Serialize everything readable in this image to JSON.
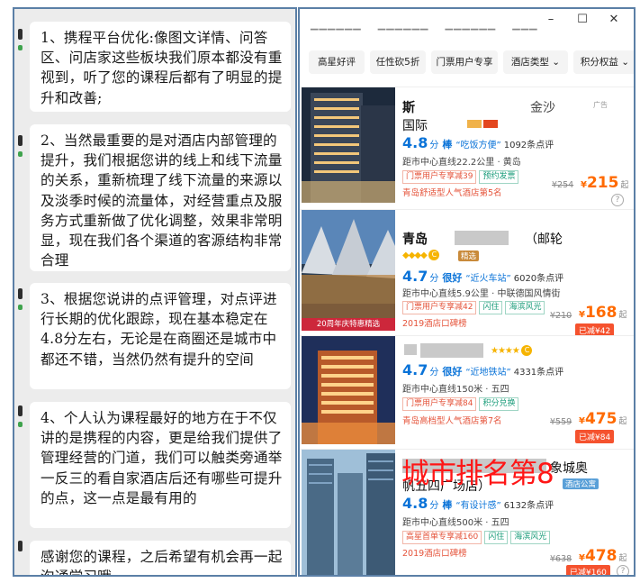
{
  "chat": {
    "messages": [
      "1、携程平台优化:像图文详情、问答区、问店家这些板块我们原本都没有重视到，听了您的课程后都有了明显的提升和改善;",
      "2、当然最重要的是对酒店内部管理的提升，我们根据您讲的线上和线下流量的关系，重新梳理了线下流量的来源以及淡季时候的流量体，对经营重点及服务方式重新做了优化调整，效果非常明显，现在我们各个渠道的客源结构非常合理",
      "3、根据您说讲的点评管理，对点评进行长期的优化跟踪，现在基本稳定在4.8分左右，无论是在商圈还是城市中都还不错，当然仍然有提升的空间",
      "4、个人认为课程最好的地方在于不仅讲的是携程的内容，更是给我们提供了管理经营的门道，我们可以触类旁通举一反三的看自家酒店后还有哪些可提升的点，这一点是最有用的",
      "感谢您的课程，之后希望有机会再一起沟通学习哦"
    ]
  },
  "window": {
    "minimize": "–",
    "maximize": "☐",
    "close": "✕"
  },
  "filters": [
    "高星好评",
    "任性砍5折",
    "门票用户专享",
    "酒店类型",
    "积分权益"
  ],
  "filter_caret": "⌄",
  "hotels": [
    {
      "name": "斯",
      "name2": "国际",
      "name_tail": "金沙",
      "ad": "广告",
      "score": "4.8",
      "score_unit": "分",
      "level": "棒",
      "quote": "“吃饭方便”",
      "reviews": "1092条点评",
      "distance": "距市中心直线22.2公里 · 黄岛",
      "tags": [
        {
          "text": "门票用户专享减39",
          "green": false
        },
        {
          "text": "预约发票",
          "green": true
        }
      ],
      "rank": "青岛舒适型人气酒店第5名",
      "old_price": "¥254",
      "price_sym": "¥",
      "price": "215",
      "price_suffix": "起"
    },
    {
      "name": "青岛",
      "name_tail": "（邮轮",
      "badge": "精选",
      "photo_banner": "20周年庆特惠精选",
      "score": "4.7",
      "score_unit": "分",
      "level": "很好",
      "quote": "“近火车站”",
      "reviews": "6020条点评",
      "distance": "距市中心直线5.9公里 · 中联德国风情街",
      "tags": [
        {
          "text": "门票用户专享减42",
          "green": false
        },
        {
          "text": "闪住",
          "green": true
        },
        {
          "text": "海滨风光",
          "green": true
        }
      ],
      "rank": "2019酒店口碑榜",
      "old_price": "¥210",
      "price_sym": "¥",
      "price": "168",
      "price_suffix": "起",
      "discount": "已减¥42"
    },
    {
      "name": "",
      "score": "4.7",
      "score_unit": "分",
      "level": "很好",
      "quote": "“近地铁站”",
      "reviews": "4331条点评",
      "distance": "距市中心直线150米 · 五四",
      "tags": [
        {
          "text": "门票用户专享减84",
          "green": false
        },
        {
          "text": "积分兑换",
          "green": true
        }
      ],
      "rank": "青岛高档型人气酒店第7名",
      "old_price": "¥559",
      "price_sym": "¥",
      "price": "475",
      "price_suffix": "起",
      "discount": "已减¥84"
    },
    {
      "name": "象城奥",
      "name2": "帆五四广场店）",
      "badge": "酒店公寓",
      "score": "4.8",
      "score_unit": "分",
      "level": "棒",
      "quote": "“有设计感”",
      "reviews": "6132条点评",
      "distance": "距市中心直线500米 · 五四",
      "tags": [
        {
          "text": "高星首单专享减160",
          "green": false
        },
        {
          "text": "闪住",
          "green": true
        },
        {
          "text": "海滨风光",
          "green": true
        }
      ],
      "rank": "2019酒店口碑榜",
      "old_price": "¥638",
      "price_sym": "¥",
      "price": "478",
      "price_suffix": "起",
      "discount": "已减¥160"
    }
  ],
  "overlay_text": "城市排名第8",
  "colors": {
    "accent_blue": "#0a73d8",
    "price_orange": "#ff6a00",
    "tag_red": "#e5533a",
    "overlay_red": "#ff1616"
  }
}
